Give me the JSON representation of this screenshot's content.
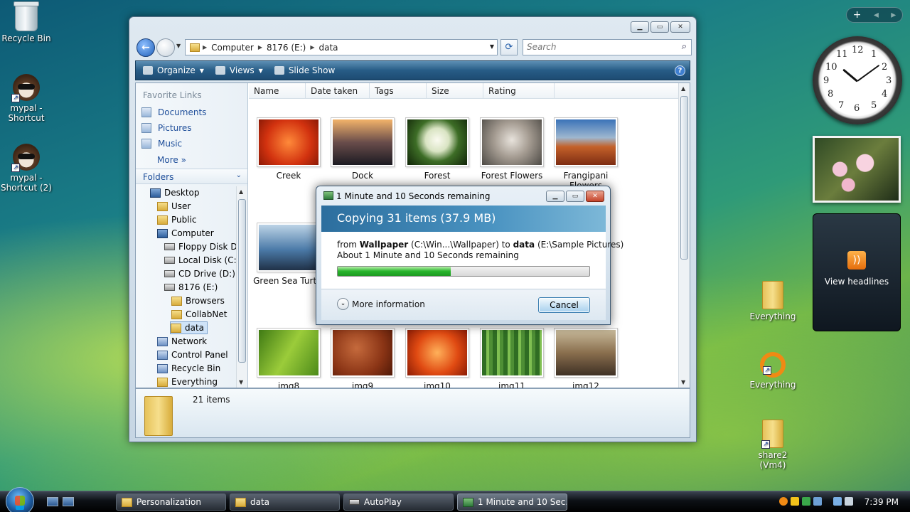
{
  "desktop": {
    "icons": [
      {
        "label": "Recycle Bin",
        "icon": "recycle-bin-icon"
      },
      {
        "label": "mypal - Shortcut",
        "icon": "raccoon-icon"
      },
      {
        "label": "mypal - Shortcut (2)",
        "icon": "raccoon-icon"
      },
      {
        "label": "Everything",
        "icon": "folder-icon"
      },
      {
        "label": "Everything",
        "icon": "search-ring-icon"
      },
      {
        "label": "share2 (Vm4)",
        "icon": "folder-icon"
      }
    ]
  },
  "gadgets": {
    "toolbar_add": "+",
    "toolbar_prev": "◂",
    "toolbar_next": "▸",
    "clock_numbers": [
      "12",
      "1",
      "2",
      "3",
      "4",
      "5",
      "6",
      "7",
      "8",
      "9",
      "10",
      "11"
    ],
    "feed_label": "View headlines"
  },
  "explorer": {
    "address": {
      "segments": [
        "Computer",
        "8176 (E:)",
        "data"
      ]
    },
    "search_placeholder": "Search",
    "commands": {
      "organize": "Organize",
      "views": "Views",
      "slideshow": "Slide Show",
      "help": "?"
    },
    "favorites": {
      "title": "Favorite Links",
      "items": [
        "Documents",
        "Pictures",
        "Music"
      ],
      "more": "More"
    },
    "folders_label": "Folders",
    "tree": [
      {
        "label": "Desktop",
        "icon": "pc"
      },
      {
        "label": "User",
        "icon": "folder"
      },
      {
        "label": "Public",
        "icon": "folder"
      },
      {
        "label": "Computer",
        "icon": "pc"
      },
      {
        "label": "Floppy Disk Dr",
        "icon": "drive"
      },
      {
        "label": "Local Disk (C:)",
        "icon": "drive"
      },
      {
        "label": "CD Drive (D:) C",
        "icon": "drive"
      },
      {
        "label": "8176 (E:)",
        "icon": "drive"
      },
      {
        "label": "Browsers",
        "icon": "folder"
      },
      {
        "label": "CollabNet",
        "icon": "folder"
      },
      {
        "label": "data",
        "icon": "folder"
      },
      {
        "label": "Network",
        "icon": "gen"
      },
      {
        "label": "Control Panel",
        "icon": "gen"
      },
      {
        "label": "Recycle Bin",
        "icon": "gen"
      },
      {
        "label": "Everything",
        "icon": "folder"
      }
    ],
    "columns": [
      "Name",
      "Date taken",
      "Tags",
      "Size",
      "Rating"
    ],
    "files": [
      {
        "name": "Creek",
        "color": "#e2411a"
      },
      {
        "name": "Dock",
        "color": "#3d3a3e"
      },
      {
        "name": "Forest",
        "color": "#3f6c2a"
      },
      {
        "name": "Forest Flowers",
        "color": "#8a7f73"
      },
      {
        "name": "Frangipani Flowers",
        "color": "#b8582a"
      },
      {
        "name": "Green Sea Turtle",
        "color": "#496f92"
      },
      {
        "name": "img8",
        "color": "#6fa62c"
      },
      {
        "name": "img9",
        "color": "#a0461e"
      },
      {
        "name": "img10",
        "color": "#d7451a"
      },
      {
        "name": "img11",
        "color": "#4f8c3c"
      },
      {
        "name": "img12",
        "color": "#7a6450"
      }
    ],
    "status": "21 items"
  },
  "dialog": {
    "title": "1 Minute and 10 Seconds remaining",
    "heading": "Copying 31 items (37.9 MB)",
    "from_prefix": "from ",
    "from_name": "Wallpaper",
    "from_path": " (C:\\Win...\\Wallpaper) to ",
    "to_name": "data",
    "to_path": " (E:\\Sample Pictures)",
    "remaining": "About 1 Minute and 10 Seconds remaining",
    "progress": 0.45,
    "more_info": "More information",
    "cancel": "Cancel"
  },
  "taskbar": {
    "tasks": [
      "Personalization",
      "data",
      "AutoPlay",
      "1 Minute and 10 Sec..."
    ],
    "time": "7:39 PM"
  }
}
